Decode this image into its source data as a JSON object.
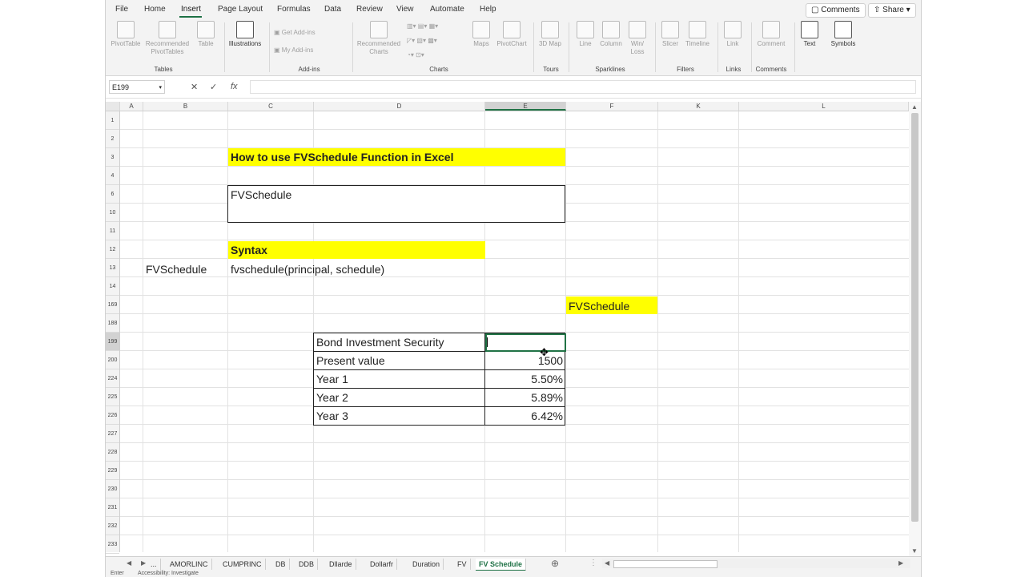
{
  "menu": {
    "tabs": [
      "File",
      "Home",
      "Insert",
      "Page Layout",
      "Formulas",
      "Data",
      "Review",
      "View",
      "Automate",
      "Help"
    ],
    "active_tab": "Insert",
    "comments_label": "Comments",
    "share_label": "Share"
  },
  "ribbon": {
    "groups": [
      {
        "label": "Tables",
        "buttons": [
          "PivotTable",
          "Recommended PivotTables",
          "Table"
        ]
      },
      {
        "label": "",
        "buttons": [
          "Illustrations"
        ]
      },
      {
        "label": "Add-ins",
        "buttons": [
          "Get Add-ins",
          "My Add-ins"
        ]
      },
      {
        "label": "Charts",
        "buttons": [
          "Recommended Charts",
          "Maps",
          "PivotChart"
        ]
      },
      {
        "label": "Tours",
        "buttons": [
          "3D Map"
        ]
      },
      {
        "label": "Sparklines",
        "buttons": [
          "Line",
          "Column",
          "Win/ Loss"
        ]
      },
      {
        "label": "Filters",
        "buttons": [
          "Slicer",
          "Timeline"
        ]
      },
      {
        "label": "Links",
        "buttons": [
          "Link"
        ]
      },
      {
        "label": "Comments",
        "buttons": [
          "Comment"
        ]
      },
      {
        "label": "",
        "buttons": [
          "Text",
          "Symbols"
        ]
      }
    ]
  },
  "formula_bar": {
    "name_box": "E199",
    "formula": ""
  },
  "columns": [
    "A",
    "B",
    "C",
    "D",
    "E",
    "F",
    "K",
    "L"
  ],
  "rows": [
    "1",
    "2",
    "3",
    "4",
    "6",
    "10",
    "11",
    "12",
    "13",
    "14",
    "169",
    "188",
    "199",
    "200",
    "224",
    "225",
    "226",
    "227",
    "228",
    "229",
    "230",
    "231",
    "232",
    "233"
  ],
  "sheet": {
    "title": "How to use FVSchedule Function in Excel",
    "box_label": "FVSchedule",
    "syntax_heading": "Syntax",
    "syntax_name": "FVSchedule",
    "syntax_formula": "fvschedule(principal, schedule)",
    "result_label": "FVSchedule",
    "table": {
      "header": "Bond Investment Security",
      "rows": [
        {
          "label": "Present value",
          "value": "1500"
        },
        {
          "label": "Year 1",
          "value": "5.50%"
        },
        {
          "label": "Year 2",
          "value": "5.89%"
        },
        {
          "label": "Year 3",
          "value": "6.42%"
        }
      ]
    }
  },
  "sheet_tabs": [
    "...",
    "AMORLINC",
    "CUMPRINC",
    "DB",
    "DDB",
    "Dllarde",
    "Dollarfr",
    "Duration",
    "FV",
    "FV Schedule"
  ],
  "active_sheet": "FV Schedule",
  "status": {
    "mode": "Enter",
    "accessibility": "Accessibility: Investigate"
  }
}
